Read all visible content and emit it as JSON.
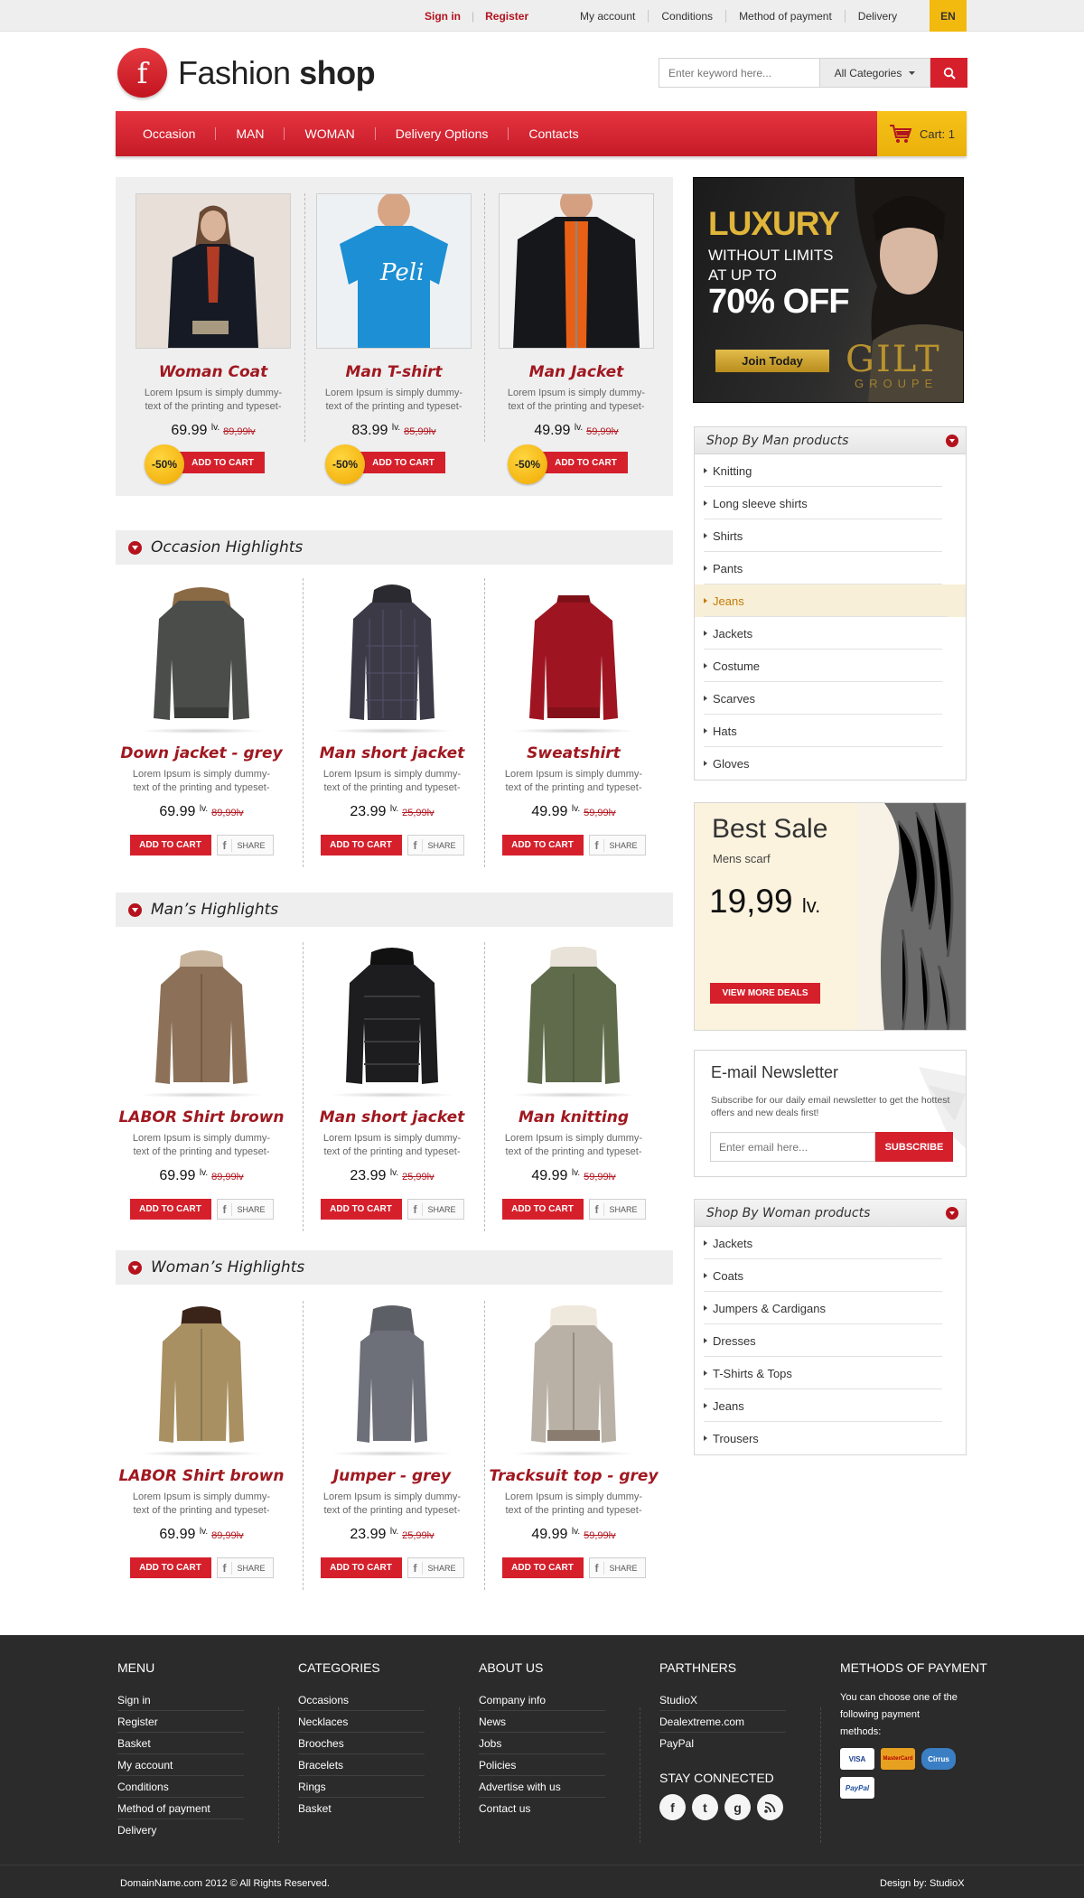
{
  "topbar": {
    "sign_in": "Sign in",
    "register": "Register",
    "links": [
      "My account",
      "Conditions",
      "Method of payment",
      "Delivery"
    ],
    "lang": "EN"
  },
  "header": {
    "logo_letter": "f",
    "logo_light": "Fashion ",
    "logo_bold": "shop",
    "search_placeholder": "Enter keyword here...",
    "category_select": "All Categories"
  },
  "nav": {
    "items": [
      "Occasion",
      "MAN",
      "WOMAN",
      "Delivery Options",
      "Contacts"
    ],
    "cart": "Cart: 1"
  },
  "featured": [
    {
      "name": "Woman Coat",
      "desc1": "Lorem Ipsum is simply dummy-",
      "desc2": "text of the printing and typeset-",
      "price": "69.99",
      "currency": "lv.",
      "old": "89,99lv",
      "badge": "-50%",
      "cta": "ADD TO CART"
    },
    {
      "name": "Man T-shirt",
      "desc1": "Lorem Ipsum is simply dummy-",
      "desc2": "text of the printing and typeset-",
      "price": "83.99",
      "currency": "lv.",
      "old": "85,99lv",
      "badge": "-50%",
      "cta": "ADD TO CART"
    },
    {
      "name": "Man Jacket",
      "desc1": "Lorem Ipsum is simply dummy-",
      "desc2": "text of the printing and typeset-",
      "price": "49.99",
      "currency": "lv.",
      "old": "59,99lv",
      "badge": "-50%",
      "cta": "ADD TO CART"
    }
  ],
  "sections": [
    {
      "title": "Occasion Highlights",
      "products": [
        {
          "name": "Down jacket - grey",
          "price": "69.99",
          "old": "89,99lv"
        },
        {
          "name": "Man short jacket",
          "price": "23.99",
          "old": "25,99lv"
        },
        {
          "name": "Sweatshirt",
          "price": "49.99",
          "old": "59,99lv"
        }
      ]
    },
    {
      "title": "Man’s Highlights",
      "products": [
        {
          "name": "LABOR Shirt brown",
          "price": "69.99",
          "old": "89,99lv"
        },
        {
          "name": "Man short jacket",
          "price": "23.99",
          "old": "25,99lv"
        },
        {
          "name": "Man knitting",
          "price": "49.99",
          "old": "59,99lv"
        }
      ]
    },
    {
      "title": "Woman’s Highlights",
      "products": [
        {
          "name": "LABOR Shirt brown",
          "price": "69.99",
          "old": "89,99lv"
        },
        {
          "name": "Jumper - grey",
          "price": "23.99",
          "old": "25,99lv"
        },
        {
          "name": "Tracksuit top - grey",
          "price": "49.99",
          "old": "59,99lv"
        }
      ]
    }
  ],
  "product_common": {
    "desc1": "Lorem Ipsum is simply dummy-",
    "desc2": "text of the printing and typeset-",
    "currency": "lv.",
    "add_to_cart": "ADD TO CART",
    "share": "SHARE"
  },
  "banner": {
    "line1": "LUXURY",
    "line2": "WITHOUT LIMITS",
    "line3": "AT UP TO",
    "line4": "70% OFF",
    "cta": "Join Today",
    "brand": "GILT",
    "brand_sub": "GROUPE"
  },
  "man_categories": {
    "title": "Shop By Man products",
    "items": [
      "Knitting",
      "Long sleeve shirts",
      "Shirts",
      "Pants",
      "Jeans",
      "Jackets",
      "Costume",
      "Scarves",
      "Hats",
      "Gloves"
    ],
    "active": "Jeans"
  },
  "best_sale": {
    "title": "Best Sale",
    "subtitle": "Mens scarf",
    "price": "19,99",
    "currency": "lv.",
    "cta": "VIEW MORE DEALS"
  },
  "newsletter": {
    "title": "E-mail Newsletter",
    "desc": "Subscribe for our daily email newsletter to get the hottest offers and new deals first!",
    "placeholder": "Enter email here...",
    "cta": "SUBSCRIBE"
  },
  "woman_categories": {
    "title": "Shop By Woman products",
    "items": [
      "Jackets",
      "Coats",
      "Jumpers & Cardigans",
      "Dresses",
      "T-Shirts & Tops",
      "Jeans",
      "Trousers"
    ]
  },
  "footer": {
    "menu": {
      "title": "MENU",
      "items": [
        "Sign in",
        "Register",
        "Basket",
        "My account",
        "Conditions",
        "Method of payment",
        "Delivery"
      ]
    },
    "categories": {
      "title": "CATEGORIES",
      "items": [
        "Occasions",
        "Necklaces",
        "Brooches",
        "Bracelets",
        "Rings",
        "Basket"
      ]
    },
    "about": {
      "title": "ABOUT US",
      "items": [
        "Company info",
        "News",
        "Jobs",
        "Policies",
        "Advertise with us",
        "Contact us"
      ]
    },
    "partners": {
      "title": "PARTHNERS",
      "items": [
        "StudioX",
        "Dealextreme.com",
        "PayPal"
      ]
    },
    "stay_connected": "STAY CONNECTED",
    "payment": {
      "title": "METHODS OF PAYMENT",
      "desc": "You can choose one of the following payment methods:",
      "cards": [
        "VISA",
        "MasterCard",
        "Cirrus",
        "PayPal"
      ]
    },
    "copyright": "DomainName.com 2012 © All Rights Reserved.",
    "design": "Design by: StudioX"
  },
  "colors": {
    "accent": "#d5202c",
    "gold": "#f2b90f",
    "footer_bg": "#2b2b2b"
  }
}
